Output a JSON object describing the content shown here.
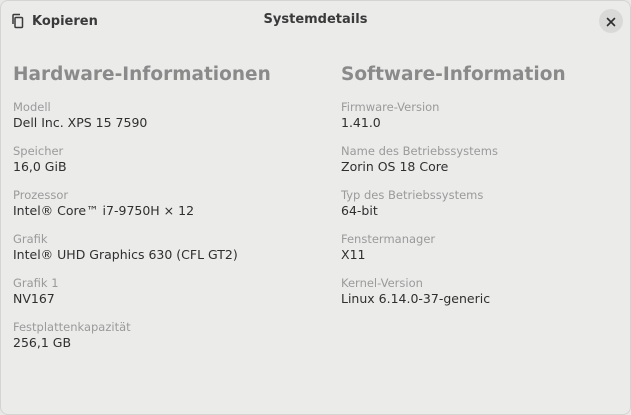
{
  "window": {
    "title": "Systemdetails",
    "copy_label": "Kopieren",
    "copy_icon": "copy-icon",
    "close_icon": "close-icon"
  },
  "hardware": {
    "title": "Hardware-Informationen",
    "rows": [
      {
        "label": "Modell",
        "value": "Dell Inc. XPS 15 7590"
      },
      {
        "label": "Speicher",
        "value": "16,0 GiB"
      },
      {
        "label": "Prozessor",
        "value": "Intel® Core™ i7-9750H × 12"
      },
      {
        "label": "Grafik",
        "value": "Intel® UHD Graphics 630 (CFL GT2)"
      },
      {
        "label": "Grafik 1",
        "value": "NV167"
      },
      {
        "label": "Festplattenkapazität",
        "value": "256,1 GB"
      }
    ]
  },
  "software": {
    "title": "Software-Information",
    "rows": [
      {
        "label": "Firmware-Version",
        "value": "1.41.0"
      },
      {
        "label": "Name des Betriebssystems",
        "value": "Zorin OS 18 Core"
      },
      {
        "label": "Typ des Betriebssystems",
        "value": "64-bit"
      },
      {
        "label": "Fenstermanager",
        "value": "X11"
      },
      {
        "label": "Kernel-Version",
        "value": "Linux 6.14.0-37-generic"
      }
    ]
  }
}
